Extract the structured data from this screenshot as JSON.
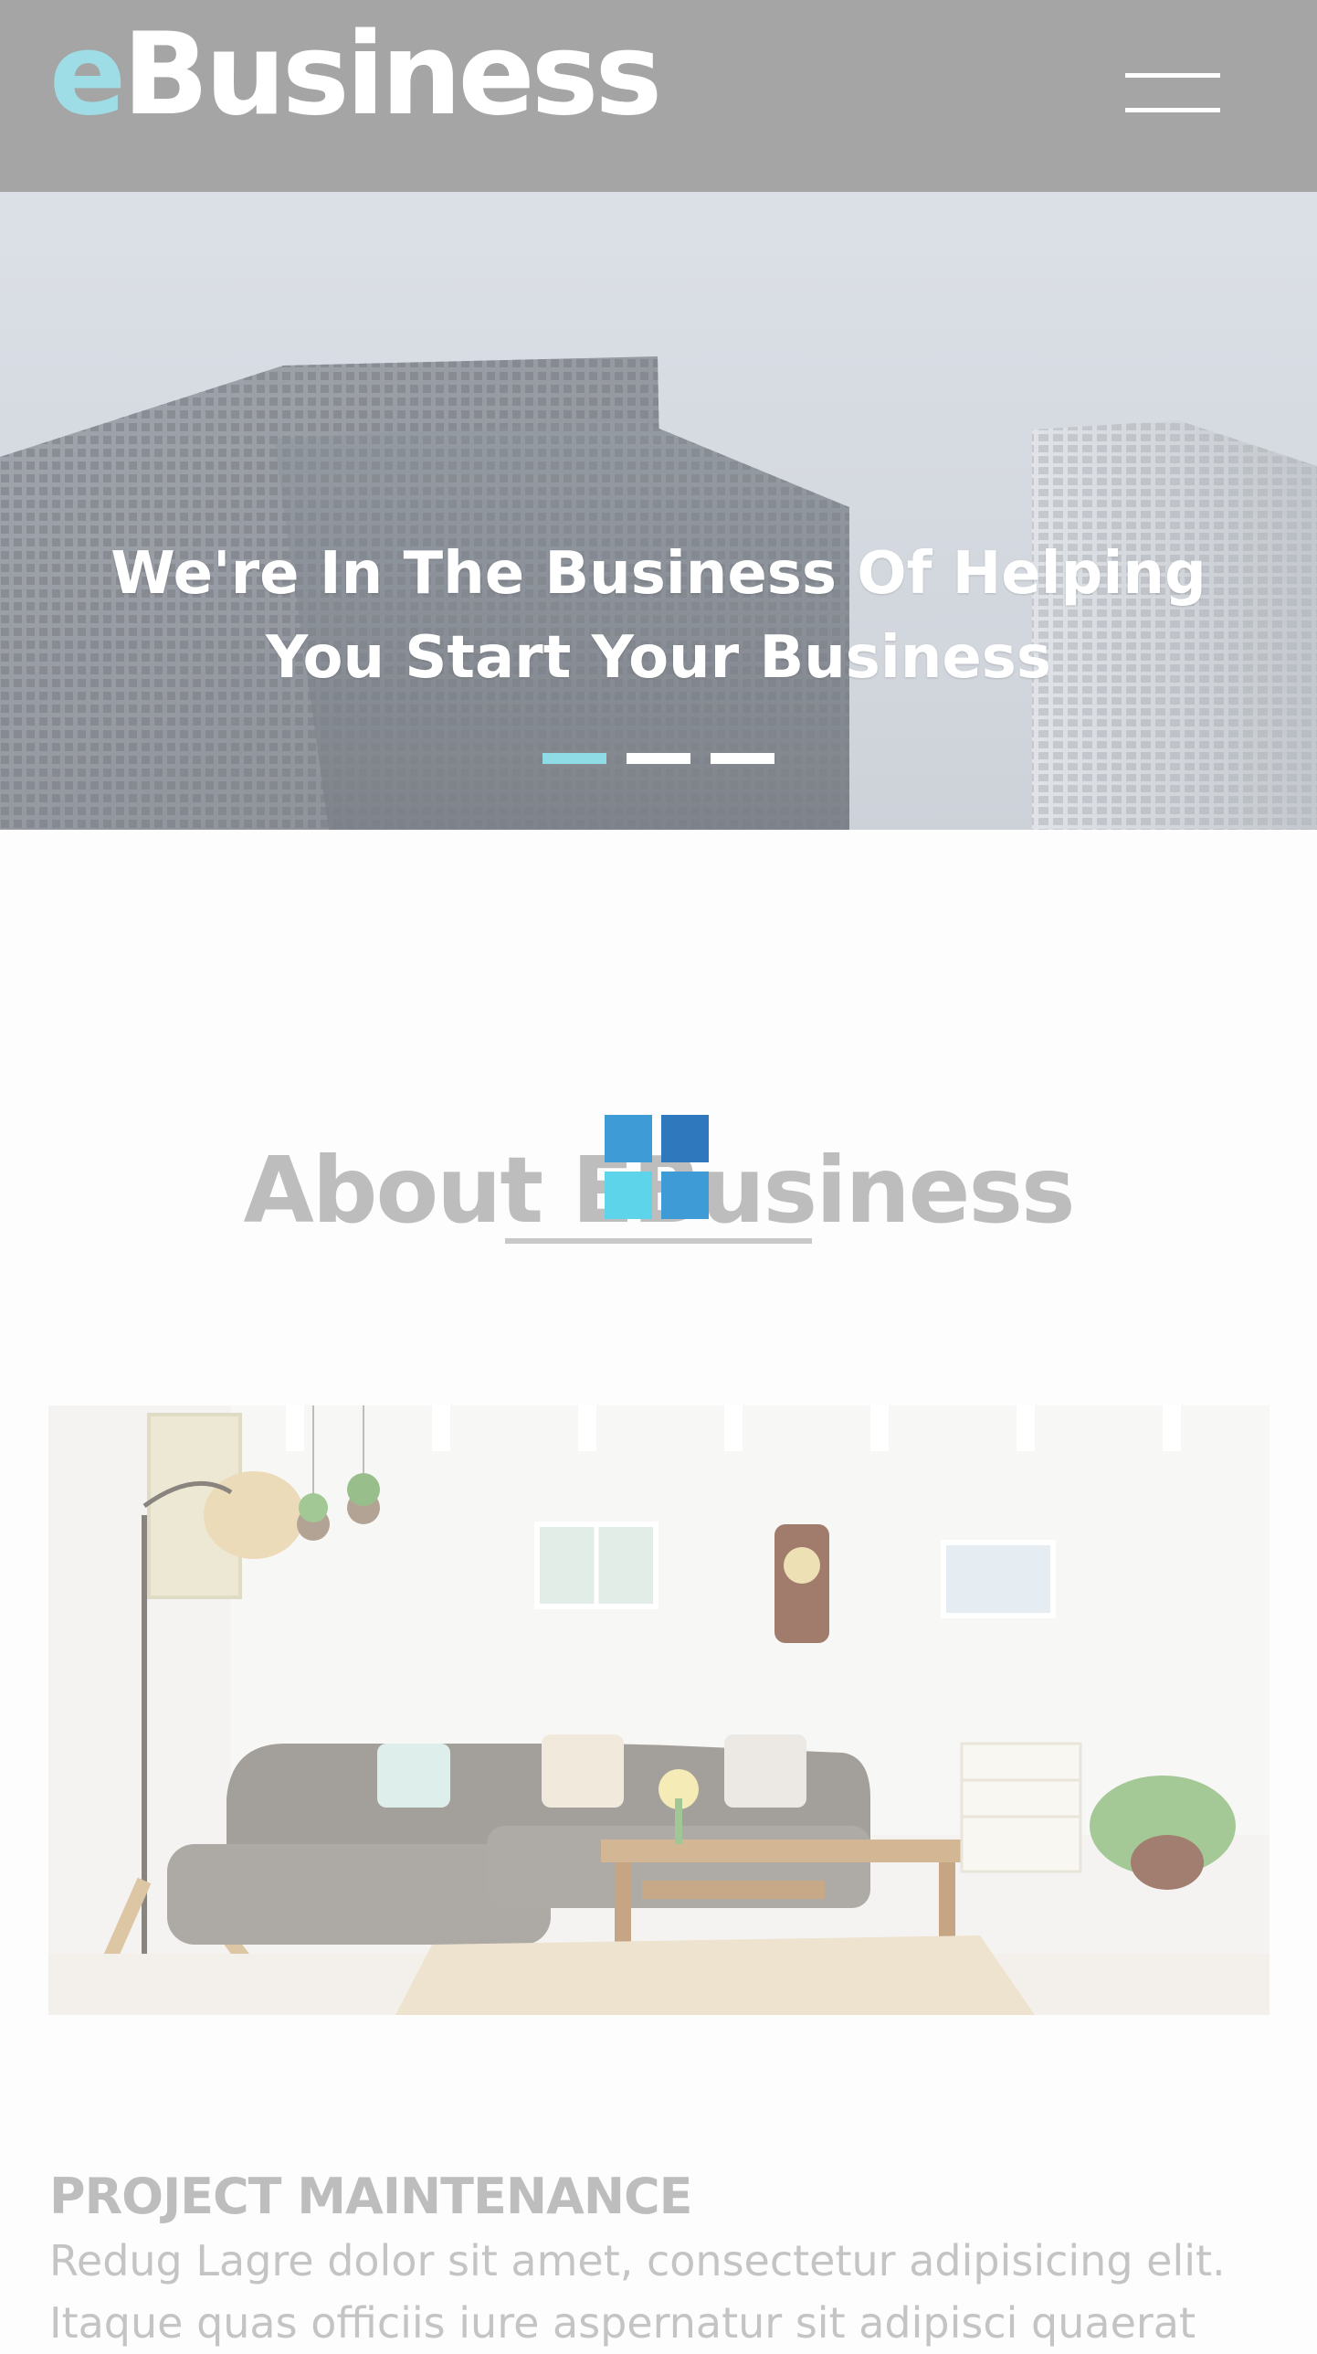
{
  "header": {
    "logo_accent": "e",
    "logo_rest": "Business",
    "menu_icon": "hamburger-icon"
  },
  "hero": {
    "title": "We're In The Business Of Helping You Start Your Business",
    "slides": 3,
    "active_slide": 1
  },
  "about": {
    "heading": "About EBusiness",
    "loader_icon": "loading-grid-icon"
  },
  "project": {
    "title": "PROJECT MAINTENANCE",
    "text": "Redug Lagre dolor sit amet, consectetur adipisicing elit. Itaque quas officiis iure aspernatur sit adipisci quaerat"
  },
  "colors": {
    "accent": "#8fdce6",
    "header_bg": "#a5a5a5",
    "loader_dark": "#2f78bd",
    "loader_mid": "#3f9bd6",
    "loader_light": "#5ed4ea"
  }
}
